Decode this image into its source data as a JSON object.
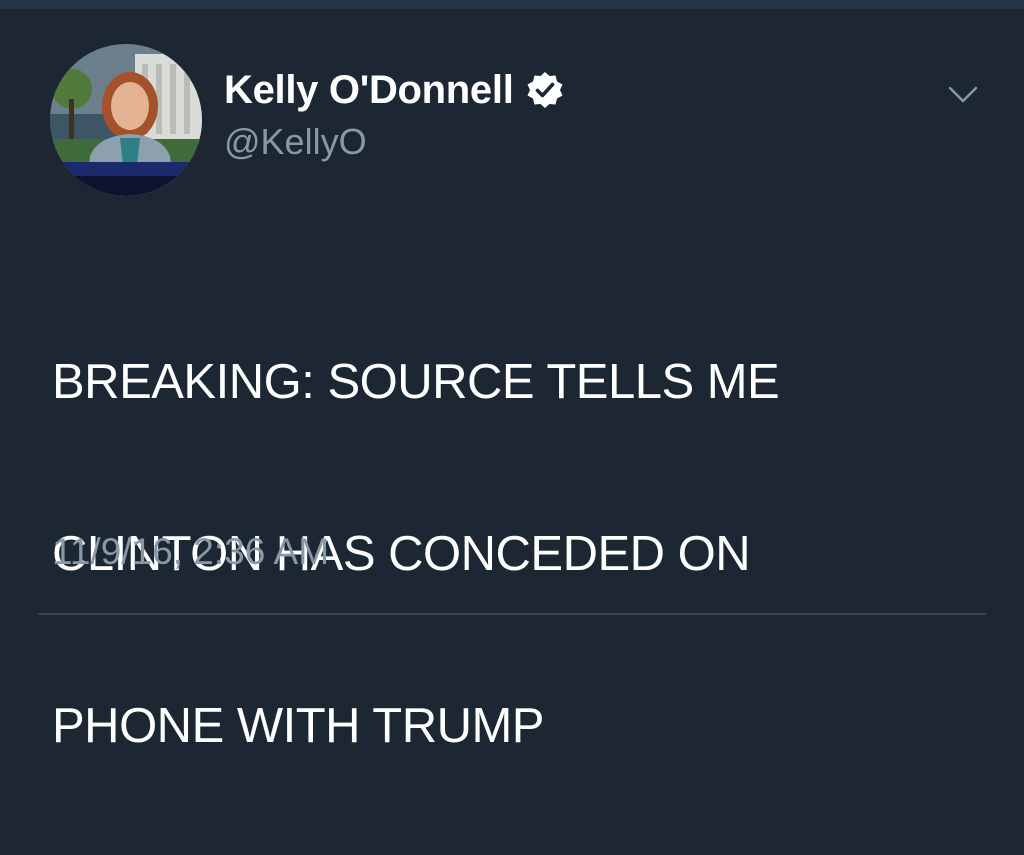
{
  "tweet": {
    "author": {
      "display_name": "Kelly O'Donnell",
      "handle": "@KellyO",
      "verified": true,
      "avatar_caption": "THE WHITE HOUSE"
    },
    "text_lines": [
      "BREAKING:  SOURCE TELLS ME",
      "CLINTON HAS CONCEDED ON",
      "PHONE WITH TRUMP"
    ],
    "timestamp": "11/9/16, 2:36 AM"
  },
  "icons": {
    "verified": "verified-badge-icon",
    "more": "chevron-down-icon"
  },
  "colors": {
    "background": "#1c2733",
    "primary_text": "#ffffff",
    "secondary_text": "#8899a6",
    "divider": "#38444d"
  }
}
